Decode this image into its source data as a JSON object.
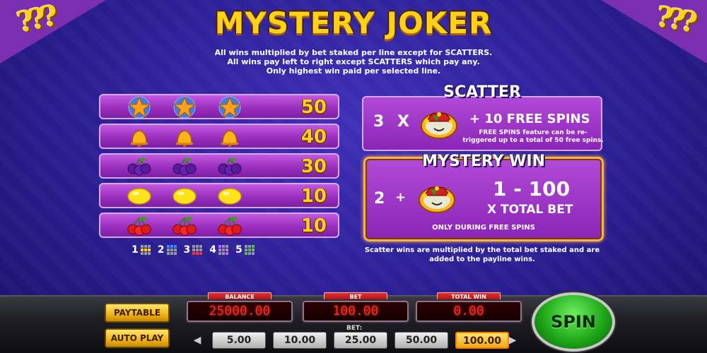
{
  "title": "MYSTERY JOKER",
  "rules": [
    "All wins multiplied by bet staked per line except for SCATTERS.",
    "All wins pay left to right except SCATTERS which pay any.",
    "Only highest win paid per selected line."
  ],
  "paytable": [
    {
      "symbol": "star-icon",
      "value": "50"
    },
    {
      "symbol": "bell-icon",
      "value": "40"
    },
    {
      "symbol": "plum-icon",
      "value": "30"
    },
    {
      "symbol": "lemon-icon",
      "value": "10"
    },
    {
      "symbol": "cherry-icon",
      "value": "10"
    }
  ],
  "lines": [
    "1",
    "2",
    "3",
    "4",
    "5"
  ],
  "scatter": {
    "title": "SCATTER",
    "count": "3",
    "times": "X",
    "prize": "+ 10 FREE SPINS",
    "note": "FREE SPINS feature can be re-triggered up to a total of 50 free spins."
  },
  "mystery": {
    "title": "MYSTERY WIN",
    "count": "2",
    "plus": "+",
    "range": "1 - 100",
    "multiplier": "X TOTAL BET",
    "note": "ONLY DURING FREE SPINS"
  },
  "scatter_footnote": "Scatter wins are multiplied by the total bet staked and are added to the payline wins.",
  "controls": {
    "paytable_label": "PAYTABLE",
    "autoplay_label": "AUTO PLAY",
    "balance_label": "BALANCE",
    "balance_value": "25000.00",
    "bet_label": "BET",
    "bet_value": "100.00",
    "total_win_label": "TOTAL WIN",
    "total_win_value": "0.00",
    "bet_options_label": "BET:",
    "bet_options": [
      "5.00",
      "10.00",
      "25.00",
      "50.00",
      "100.00"
    ],
    "selected_bet": "100.00",
    "prev_label": "◀",
    "next_label": "▶",
    "spin_label": "SPIN"
  },
  "colors": {
    "accent_gold": "#ffd21a",
    "panel_purple": "#9b2fbf",
    "background_blue": "#2a1e92",
    "led_red": "#e8322a",
    "spin_green": "#1fa81a"
  }
}
